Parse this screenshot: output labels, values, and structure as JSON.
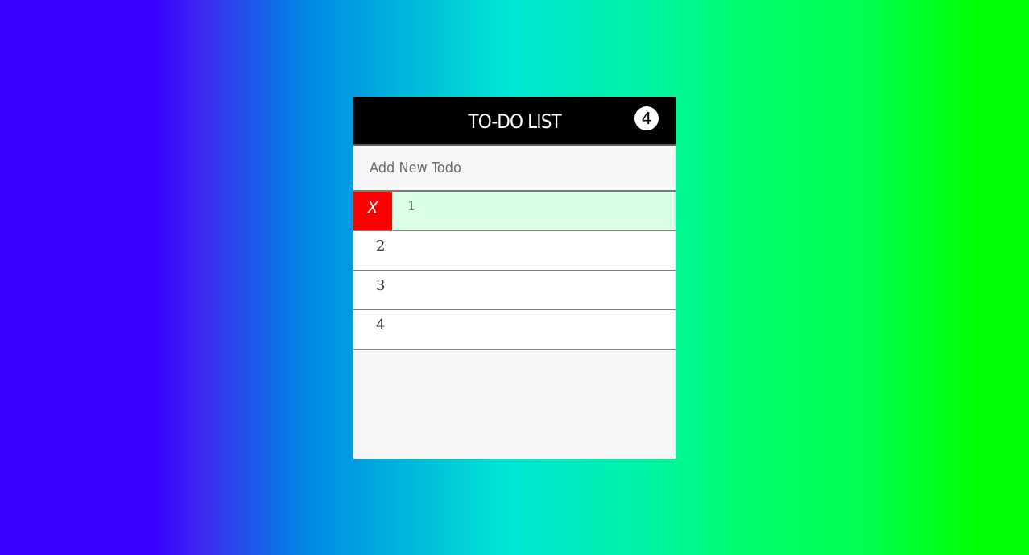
{
  "header": {
    "title": "TO-DO LIST",
    "count": "4"
  },
  "input": {
    "placeholder": "Add New Todo",
    "value": ""
  },
  "todos": [
    {
      "text": "1",
      "delete_label": "X"
    },
    {
      "text": "2"
    },
    {
      "text": "3"
    },
    {
      "text": "4"
    }
  ],
  "colors": {
    "header_bg": "#000000",
    "delete_bg": "#ff0000",
    "highlight_bg": "#d8fee6",
    "gradient_start": "#3a00ff",
    "gradient_mid": "#00e5d6",
    "gradient_end": "#00ff00"
  }
}
